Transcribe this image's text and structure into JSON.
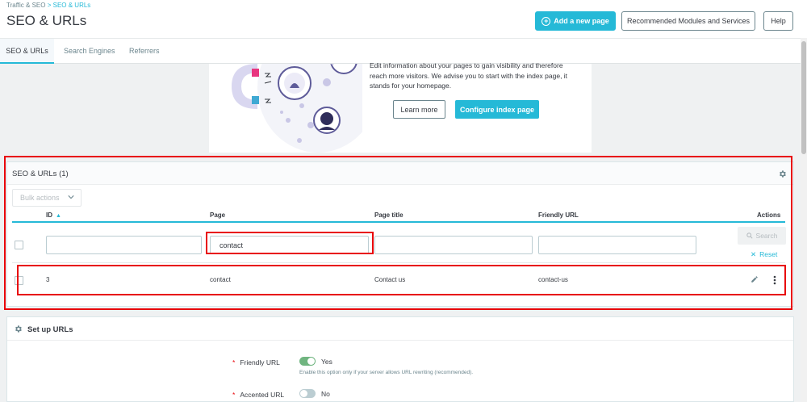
{
  "header": {
    "breadcrumb": {
      "parent": "Traffic & SEO",
      "separator": ">",
      "current": "SEO & URLs"
    },
    "title": "SEO & URLs",
    "buttons": {
      "add_new_page": "Add a new page",
      "recommended_modules": "Recommended Modules and Services",
      "help": "Help"
    }
  },
  "tabs": [
    {
      "label": "SEO & URLs",
      "active": true
    },
    {
      "label": "Search Engines",
      "active": false
    },
    {
      "label": "Referrers",
      "active": false
    }
  ],
  "helper_card": {
    "text": "Edit information about your pages to gain visibility and therefore reach more visitors. We advise you to start with the index page, it stands for your homepage.",
    "learn_more": "Learn more",
    "configure": "Configure index page"
  },
  "list_panel": {
    "title": "SEO & URLs (1)",
    "bulk_actions": "Bulk actions",
    "columns": {
      "id": "ID",
      "page": "Page",
      "page_title": "Page title",
      "friendly_url": "Friendly URL",
      "actions": "Actions"
    },
    "filters": {
      "id": "",
      "page": "contact",
      "page_title": "",
      "friendly_url": ""
    },
    "search_label": "Search",
    "reset_label": "Reset",
    "rows": [
      {
        "id": "3",
        "page": "contact",
        "page_title": "Contact us",
        "friendly_url": "contact-us"
      }
    ]
  },
  "setup_panel": {
    "title": "Set up URLs",
    "friendly_url": {
      "label": "Friendly URL",
      "value": "Yes",
      "enabled": true,
      "help": "Enable this option only if your server allows URL rewriting (recommended)."
    },
    "accented_url": {
      "label": "Accented URL",
      "value": "No",
      "enabled": false
    }
  },
  "colors": {
    "accent": "#25b9d7",
    "toggle_on": "#70b580",
    "toggle_off": "#bbcdd2",
    "highlight": "#e8060b",
    "required": "#e8060b"
  }
}
